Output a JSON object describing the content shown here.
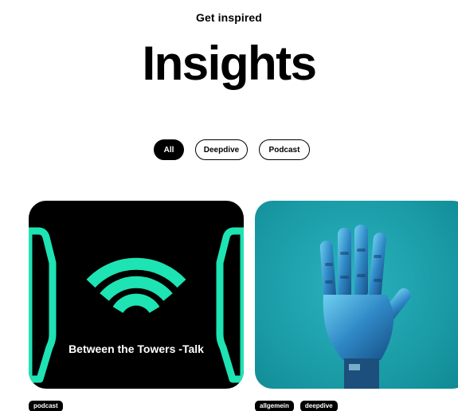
{
  "header": {
    "eyebrow": "Get inspired",
    "title": "Insights"
  },
  "filters": [
    {
      "label": "All",
      "active": true
    },
    {
      "label": "Deepdive",
      "active": false
    },
    {
      "label": "Podcast",
      "active": false
    }
  ],
  "cards": [
    {
      "title": "Between the Towers -Talk",
      "image": "podcast-wifi-graphic",
      "tags": [
        "podcast"
      ]
    },
    {
      "image": "robot-hand-photo",
      "tags": [
        "allgemein",
        "deepdive"
      ]
    }
  ],
  "colors": {
    "accent": "#1ee3b3",
    "teal_bg": "#1a9ba6"
  }
}
